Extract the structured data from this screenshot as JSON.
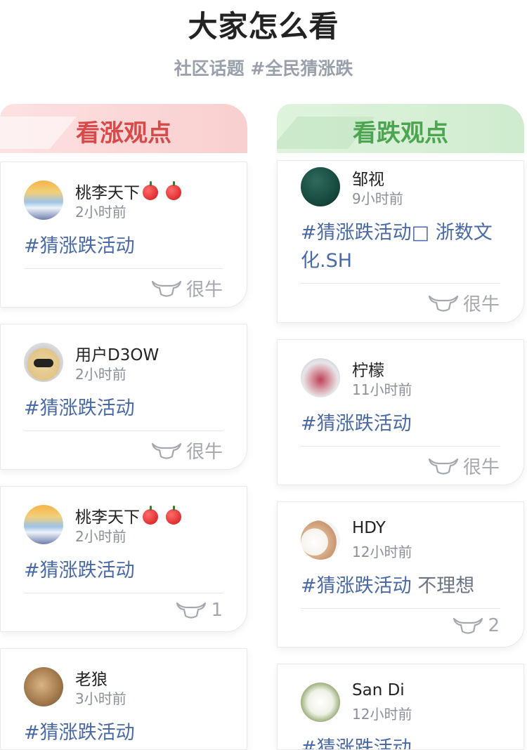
{
  "page": {
    "title": "大家怎么看",
    "subtitle": "社区话题 #全民猜涨跌"
  },
  "columns": {
    "bull": {
      "header": "看涨观点",
      "accent": "#d84a4a",
      "cards": [
        {
          "name": "桃李天下",
          "time": "2小时前",
          "post": "#猜涨跌活动",
          "extra": "",
          "like": "很牛",
          "emoji": "apple apple"
        },
        {
          "name": "用户D3OW",
          "time": "2小时前",
          "post": "#猜涨跌活动",
          "extra": "",
          "like": "很牛"
        },
        {
          "name": "桃李天下",
          "time": "2小时前",
          "post": "#猜涨跌活动",
          "extra": "",
          "like": "1",
          "emoji": "apple apple"
        },
        {
          "name": "老狼",
          "time": "3小时前",
          "post": "#猜涨跌活动",
          "extra": "",
          "like": ""
        }
      ]
    },
    "bear": {
      "header": "看跌观点",
      "accent": "#4da552",
      "cards": [
        {
          "name": "邹视",
          "time": "9小时前",
          "post": "#猜涨跌活动□ 浙数文化.SH",
          "extra": "",
          "like": "很牛"
        },
        {
          "name": "柠檬",
          "time": "11小时前",
          "post": "#猜涨跌活动",
          "extra": "",
          "like": "很牛"
        },
        {
          "name": "HDY",
          "time": "12小时前",
          "post": "#猜涨跌活动",
          "extra": " 不理想",
          "like": "2"
        },
        {
          "name": "San Di",
          "time": "12小时前",
          "post": "#猜涨跌活动",
          "extra": "",
          "like": ""
        }
      ]
    }
  },
  "icons": {
    "like": "bull-head-icon"
  }
}
